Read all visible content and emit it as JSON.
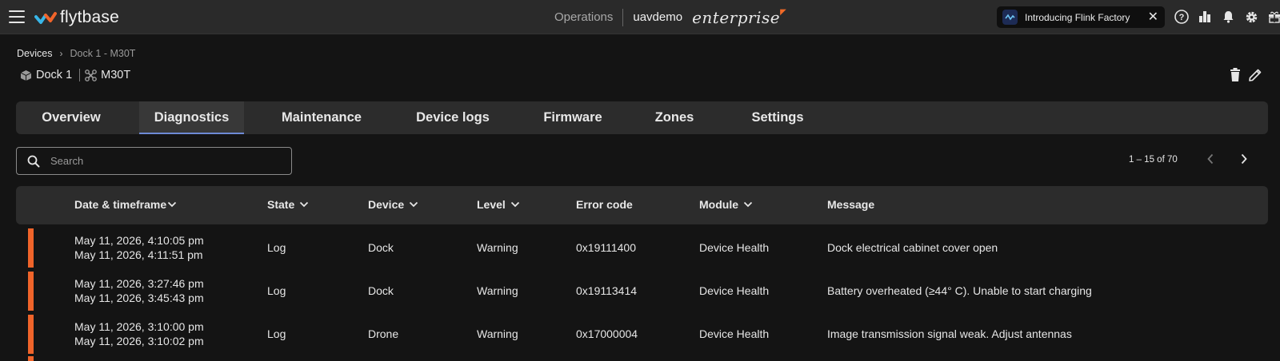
{
  "app": {
    "brand": "flytbase",
    "nav_label": "Operations",
    "org": "uavdemo",
    "edition": "enterprise",
    "announcement": "Introducing Flink Factory",
    "accent_color": "#f0642a",
    "active_tab_color": "#6e8ad6"
  },
  "icons": [
    "menu-icon",
    "help-icon",
    "analytics-icon",
    "bell-icon",
    "gear-icon",
    "gift-icon",
    "trash-icon",
    "pencil-icon",
    "search-icon",
    "chevron-down-icon",
    "chevron-left-icon",
    "chevron-right-icon",
    "close-icon",
    "dock-icon",
    "drone-icon"
  ],
  "breadcrumb": {
    "root": "Devices",
    "current": "Dock 1 - M30T"
  },
  "device": {
    "dock": "Dock 1",
    "drone": "M30T"
  },
  "tabs": [
    {
      "label": "Overview"
    },
    {
      "label": "Diagnostics",
      "active": true
    },
    {
      "label": "Maintenance"
    },
    {
      "label": "Device logs"
    },
    {
      "label": "Firmware"
    },
    {
      "label": "Zones"
    },
    {
      "label": "Settings"
    }
  ],
  "search": {
    "placeholder": "Search"
  },
  "pagination": {
    "range": "1 – 15 of 70"
  },
  "table": {
    "columns": [
      {
        "label": "Date & timeframe",
        "sortable": true
      },
      {
        "label": "State",
        "sortable": true
      },
      {
        "label": "Device",
        "sortable": true
      },
      {
        "label": "Level",
        "sortable": true
      },
      {
        "label": "Error code",
        "sortable": false
      },
      {
        "label": "Module",
        "sortable": true
      },
      {
        "label": "Message",
        "sortable": false
      }
    ],
    "rows": [
      {
        "start": "May 11, 2026, 4:10:05 pm",
        "end": "May 11, 2026, 4:11:51 pm",
        "state": "Log",
        "device": "Dock",
        "level": "Warning",
        "code": "0x19111400",
        "module": "Device Health",
        "message": "Dock electrical cabinet cover open"
      },
      {
        "start": "May 11, 2026, 3:27:46 pm",
        "end": "May 11, 2026, 3:45:43 pm",
        "state": "Log",
        "device": "Dock",
        "level": "Warning",
        "code": "0x19113414",
        "module": "Device Health",
        "message": "Battery overheated (≥44° C). Unable to start charging"
      },
      {
        "start": "May 11, 2026, 3:10:00 pm",
        "end": "May 11, 2026, 3:10:02 pm",
        "state": "Log",
        "device": "Drone",
        "level": "Warning",
        "code": "0x17000004",
        "module": "Device Health",
        "message": "Image transmission signal weak. Adjust antennas"
      }
    ]
  }
}
